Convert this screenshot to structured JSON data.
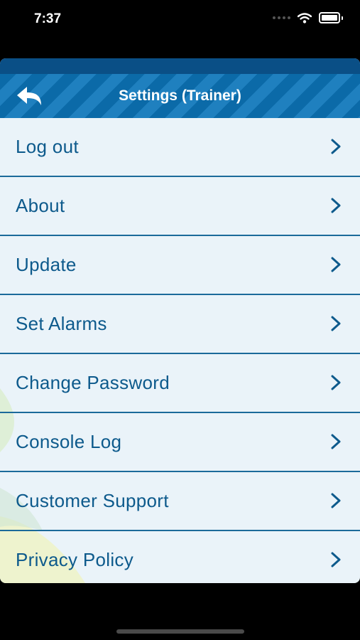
{
  "status_bar": {
    "time": "7:37"
  },
  "header": {
    "title": "Settings (Trainer)"
  },
  "menu": {
    "items": [
      {
        "label": "Log out"
      },
      {
        "label": "About"
      },
      {
        "label": "Update"
      },
      {
        "label": "Set Alarms"
      },
      {
        "label": "Change Password"
      },
      {
        "label": "Console Log"
      },
      {
        "label": "Customer Support"
      },
      {
        "label": "Privacy Policy"
      }
    ]
  },
  "colors": {
    "header_dark": "#0a4f86",
    "header_stripe": "#1f80bf",
    "menu_background": "#eaf3f9",
    "label_text": "#0d5a8c",
    "divider": "#1b6a9a"
  }
}
